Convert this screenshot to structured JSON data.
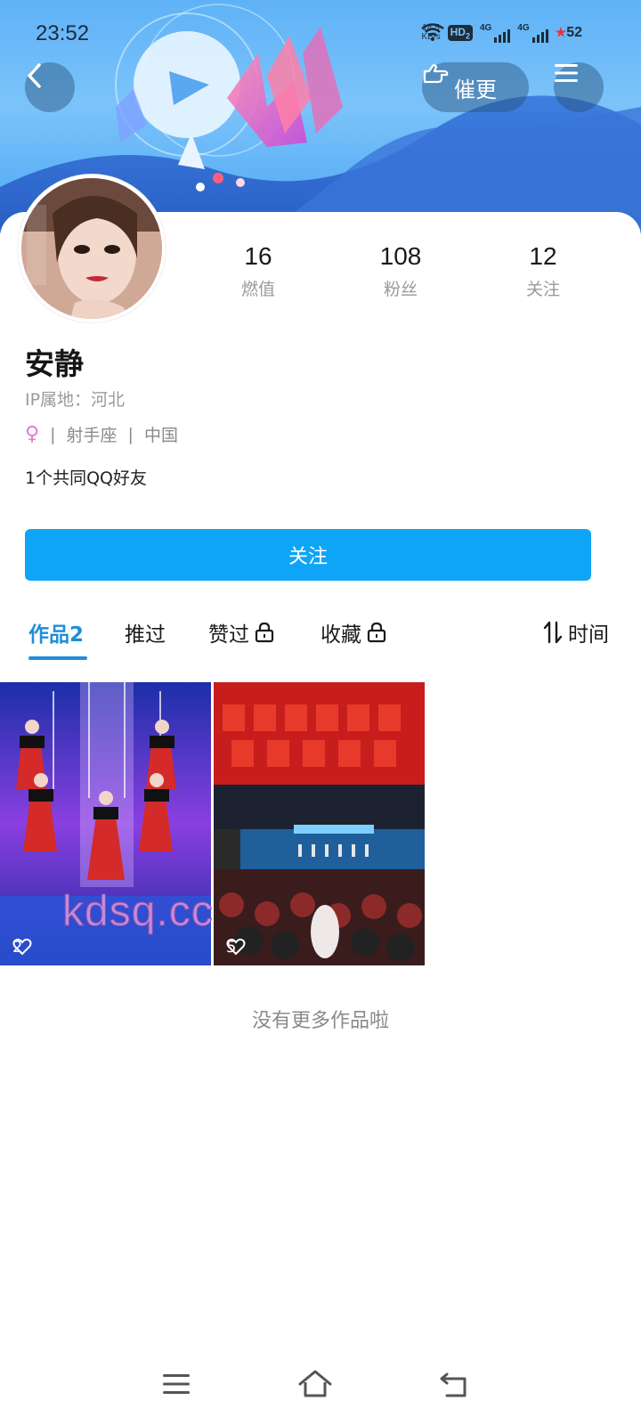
{
  "status_bar": {
    "time": "23:52",
    "net_speed_value": "14.5",
    "net_speed_unit": "KB/s",
    "hd_label": "HD",
    "hd_sub": "2",
    "network_1": "4G",
    "network_2": "4G",
    "battery": "52"
  },
  "header": {
    "urge_label": "催更"
  },
  "profile": {
    "name": "安静",
    "ip_location": "IP属地：河北",
    "zodiac": "射手座",
    "country": "中国",
    "mutual_friends": "1个共同QQ好友",
    "gender_symbol": "♀",
    "separator": "|"
  },
  "stats": [
    {
      "value": "16",
      "label": "燃值"
    },
    {
      "value": "108",
      "label": "粉丝"
    },
    {
      "value": "12",
      "label": "关注"
    }
  ],
  "follow_button": "关注",
  "tabs": [
    {
      "label": "作品2"
    },
    {
      "label": "推过"
    },
    {
      "label": "赞过"
    },
    {
      "label": "收藏"
    }
  ],
  "sort_label": "时间",
  "works": [
    {
      "likes": "2"
    },
    {
      "likes": "5"
    }
  ],
  "watermark": "kdsq.cc",
  "no_more_text": "没有更多作品啦",
  "colors": {
    "accent": "#1e8ed8",
    "follow_button": "#0ea5f6",
    "gender": "#e57bc8"
  },
  "icons": {
    "back": "chevron-left-icon",
    "urge": "hand-pointing-icon",
    "menu": "hamburger-icon",
    "lock": "lock-icon",
    "sort": "sort-arrows-icon",
    "heart": "heart-outline-icon"
  }
}
